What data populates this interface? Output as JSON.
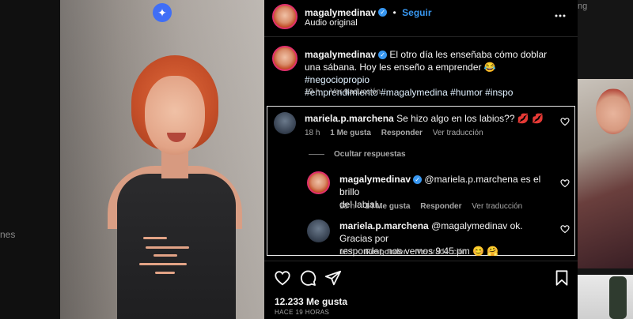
{
  "background": {
    "left_text": "nes",
    "right_text": "ng"
  },
  "post": {
    "username": "magalymedinav",
    "follow_label": "Seguir",
    "separator": "•",
    "audio": "Audio original",
    "more_icon": "more-horizontal-icon",
    "caption": {
      "text": "El otro día les enseñaba cómo doblar una sábana. Hoy les enseño a emprender 😂",
      "tags_line1": "#negociopropio",
      "tags_line2": "#emprendimiento #magalymedina #humor #inspo"
    },
    "caption_meta": {
      "time": "19 h",
      "translate": "Ver traducción"
    }
  },
  "comments": [
    {
      "username": "mariela.p.marchena",
      "text": "Se hizo algo en los labios?? 💋 💋",
      "time": "18 h",
      "likes": "1 Me gusta",
      "reply": "Responder",
      "translate": "Ver traducción"
    }
  ],
  "hide_replies": "Ocultar respuestas",
  "replies": [
    {
      "username": "magalymedinav",
      "text_line1": "@mariela.p.marchena es el brillo",
      "text_line2": "del labial...",
      "time": "18 h",
      "likes": "14 Me gusta",
      "reply": "Responder",
      "translate": "Ver traducción"
    },
    {
      "username": "mariela.p.marchena",
      "text_line1": "@magalymedinav ok. Gracias por",
      "text_line2": "responder, nos vemos 9:45 pm 😊 🤗",
      "time": "18 h",
      "reply": "Responder",
      "translate": "Ver traducción"
    }
  ],
  "footer": {
    "likes": "12.233 Me gusta",
    "time": "HACE 19 HORAS"
  },
  "icons": {
    "sparkle": "✦",
    "heart": "♡",
    "verified": "✓"
  },
  "colors": {
    "accent": "#3897f0",
    "background": "#000000",
    "text": "#f5f5f5",
    "muted": "#a8a8a8"
  }
}
